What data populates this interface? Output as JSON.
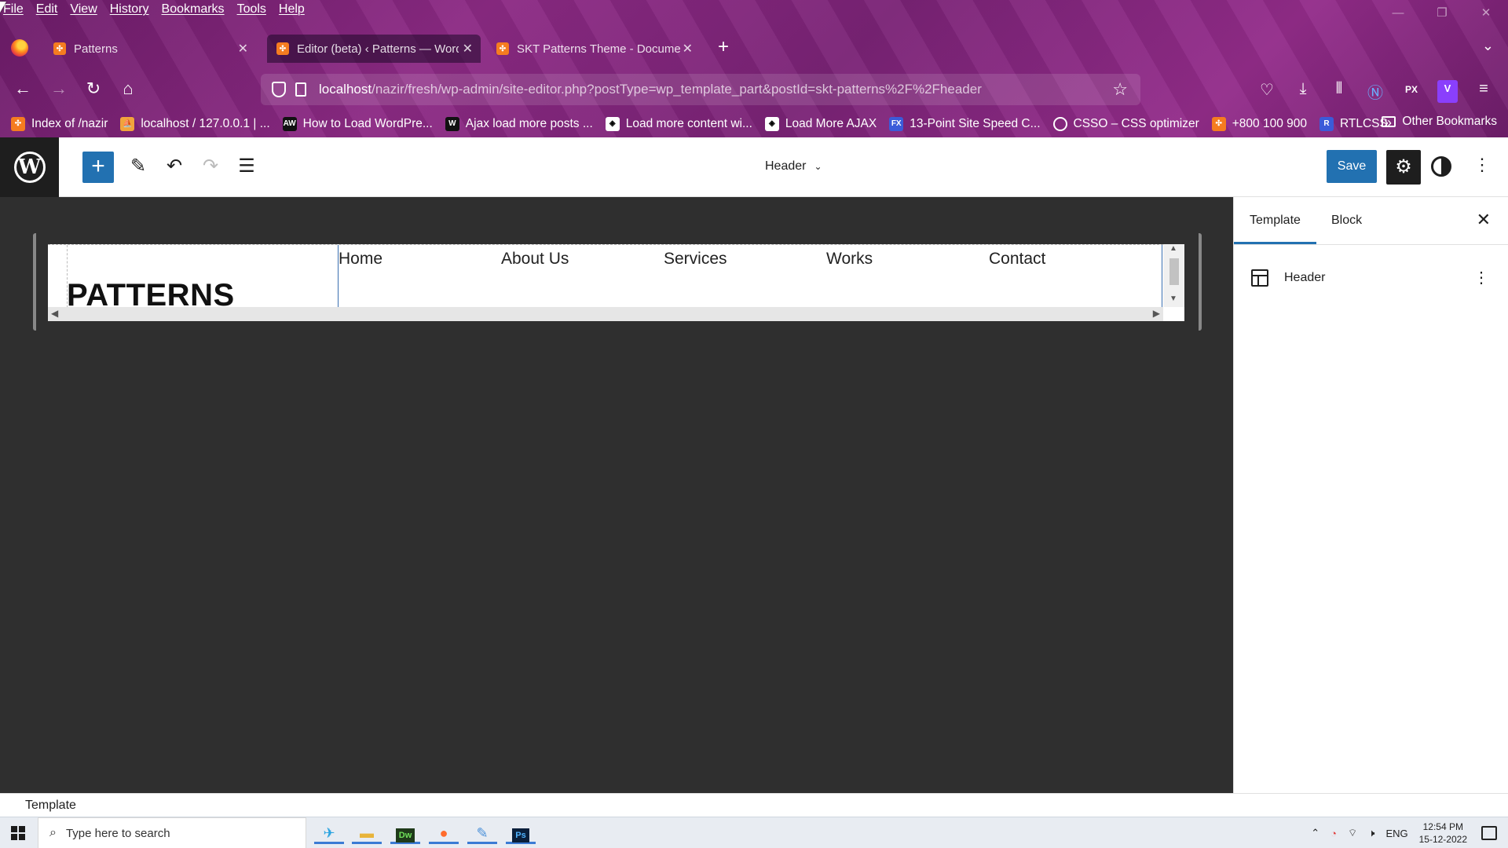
{
  "browser": {
    "menu": [
      "File",
      "Edit",
      "View",
      "History",
      "Bookmarks",
      "Tools",
      "Help"
    ],
    "window_controls": [
      "—",
      "❐",
      "✕"
    ],
    "tabs": [
      {
        "label": "Patterns",
        "active": false
      },
      {
        "label": "Editor (beta) ‹ Patterns — Word",
        "active": true
      },
      {
        "label": "SKT Patterns Theme - Documen",
        "active": false
      }
    ],
    "new_tab_label": "+",
    "url_host": "localhost",
    "url_path": "/nazir/fresh/wp-admin/site-editor.php?postType=wp_template_part&postId=skt-patterns%2F%2Fheader",
    "bookmarks": [
      {
        "label": "Index of /nazir",
        "icon": "xampp-icon"
      },
      {
        "label": "localhost / 127.0.0.1 | ...",
        "icon": "phpmyadmin-icon"
      },
      {
        "label": "How to Load WordPre...",
        "icon": "aw-icon"
      },
      {
        "label": "Ajax load more posts ...",
        "icon": "w-icon"
      },
      {
        "label": "Load more content wi...",
        "icon": "codepen-icon"
      },
      {
        "label": "Load More AJAX",
        "icon": "codepen-icon"
      },
      {
        "label": "13-Point Site Speed C...",
        "icon": "fx-icon"
      },
      {
        "label": "CSSO – CSS optimizer",
        "icon": "globe-icon"
      },
      {
        "label": "+800 100 900",
        "icon": "xampp-icon"
      },
      {
        "label": "RTLCSS",
        "icon": "rtlcss-icon"
      }
    ],
    "other_bookmarks": "Other Bookmarks"
  },
  "editor": {
    "document_title": "Header",
    "save_label": "Save",
    "canvas": {
      "site_title": "PATTERNS",
      "nav_items": [
        "Home",
        "About Us",
        "Services",
        "Works",
        "Contact"
      ]
    },
    "sidebar": {
      "tabs": [
        "Template",
        "Block"
      ],
      "active_tab": "Template",
      "template_part_label": "Header"
    },
    "footer_breadcrumb": "Template"
  },
  "taskbar": {
    "search_placeholder": "Type here to search",
    "language": "ENG",
    "time": "12:54 PM",
    "date": "15-12-2022"
  },
  "colors": {
    "wp_blue": "#2271b1",
    "canvas_bg": "#2f2f2f",
    "browser_purple": "#7a2376"
  }
}
